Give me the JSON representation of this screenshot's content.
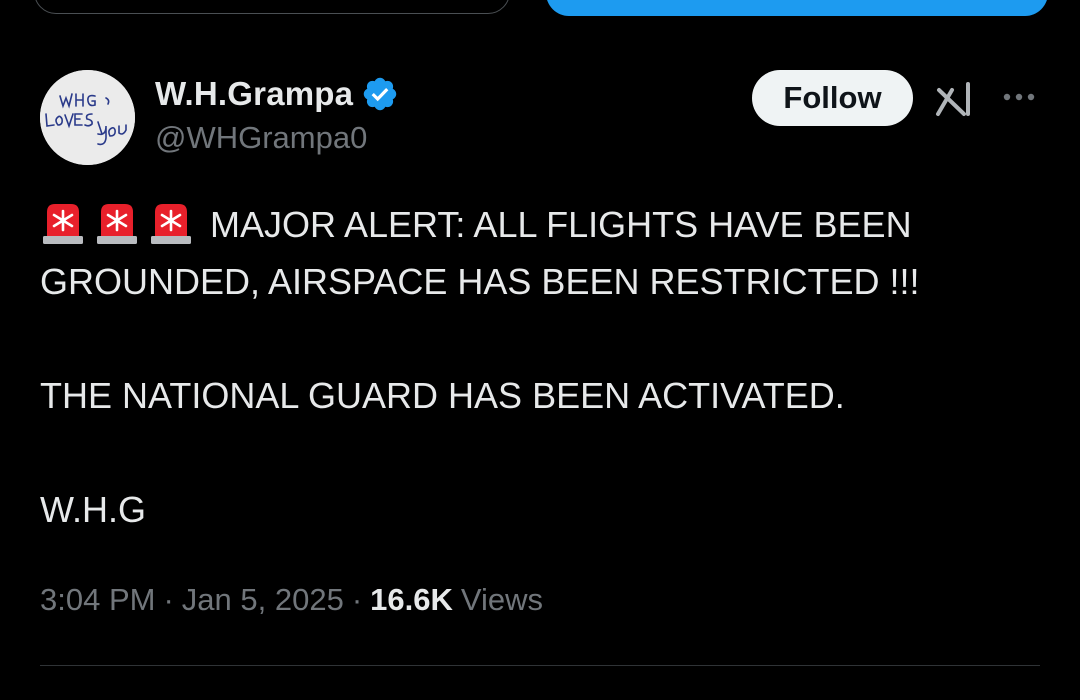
{
  "author": {
    "display_name": "W.H.Grampa",
    "handle": "@WHGrampa0",
    "verified": true,
    "avatar_text": [
      "W.H.G.",
      "LOVES",
      "You"
    ]
  },
  "actions": {
    "follow_label": "Follow",
    "grok_icon": "grok-icon",
    "more_icon": "more-options-icon"
  },
  "tweet": {
    "line_1": "MAJOR ALERT: ALL FLIGHTS HAVE BEEN",
    "line_2": "GROUNDED, AIRSPACE HAS BEEN RESTRICTED !!!",
    "line_3": "THE NATIONAL GUARD HAS BEEN ACTIVATED.",
    "line_4": "W.H.G",
    "emoji": [
      "police-car-light",
      "police-car-light",
      "police-car-light"
    ]
  },
  "meta": {
    "time": "3:04 PM",
    "separator": "·",
    "date": "Jan 5, 2025",
    "views_count": "16.6K",
    "views_label": "Views"
  },
  "colors": {
    "background": "#000000",
    "text_primary": "#e7e9ea",
    "text_secondary": "#71767b",
    "accent_blue": "#1d9bf0",
    "follow_bg": "#eff3f4",
    "divider": "#2f3336"
  }
}
